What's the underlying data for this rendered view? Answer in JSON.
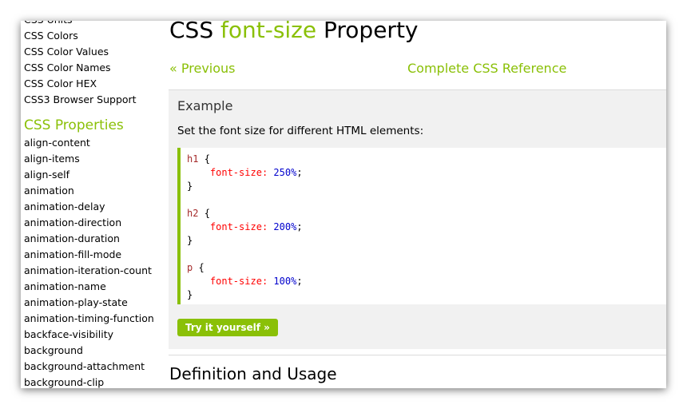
{
  "sidebar": {
    "top_links": [
      "CSS Units",
      "CSS Colors",
      "CSS Color Values",
      "CSS Color Names",
      "CSS Color HEX",
      "CSS3 Browser Support"
    ],
    "heading": "CSS Properties",
    "properties": [
      "align-content",
      "align-items",
      "align-self",
      "animation",
      "animation-delay",
      "animation-direction",
      "animation-duration",
      "animation-fill-mode",
      "animation-iteration-count",
      "animation-name",
      "animation-play-state",
      "animation-timing-function",
      "backface-visibility",
      "background",
      "background-attachment",
      "background-clip"
    ]
  },
  "main": {
    "title_prefix": "CSS ",
    "title_keyword": "font-size",
    "title_suffix": " Property",
    "prev_link": "« Previous",
    "reference_link": "Complete CSS Reference",
    "example": {
      "heading": "Example",
      "description": "Set the font size for different HTML elements:",
      "rules": [
        {
          "selector": "h1",
          "property": "font-size",
          "value": "250%"
        },
        {
          "selector": "h2",
          "property": "font-size",
          "value": "200%"
        },
        {
          "selector": "p",
          "property": "font-size",
          "value": "100%"
        }
      ],
      "open_brace": "{",
      "close_brace": "}",
      "try_button": "Try it yourself »"
    },
    "section_title": "Definition and Usage"
  },
  "colors": {
    "accent": "#8ac007",
    "selector": "#a52a2a",
    "property": "#ff0000",
    "value": "#0000cd"
  }
}
